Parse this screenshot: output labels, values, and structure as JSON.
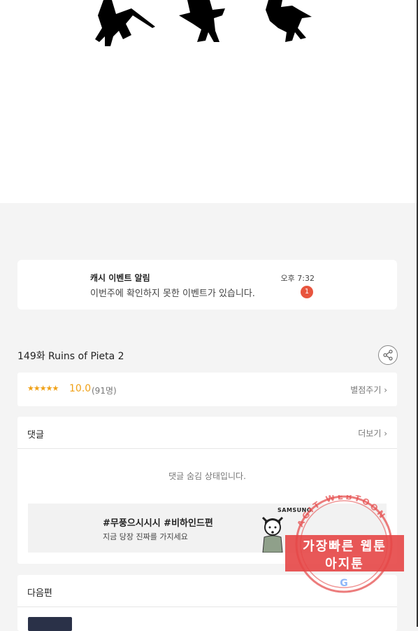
{
  "notification": {
    "title": "캐시 이벤트 알림",
    "body": "이번주에 확인하지 못한 이벤트가 있습니다.",
    "time": "오후 7:32",
    "badge": "1"
  },
  "episode": {
    "title": "149화 Ruins of Pieta 2",
    "share_icon": "share-icon"
  },
  "rating": {
    "stars": "★★★★★",
    "score": "10.0",
    "count": "(91명)",
    "rate_link": "별점주기 ›"
  },
  "comments": {
    "title": "댓글",
    "more": "더보기 ›",
    "hidden_text": "댓글 숨김 상태입니다."
  },
  "ad": {
    "headline": "#무풍으시시시 #비하인드편",
    "subline": "지금 당장 진짜를 가지세요",
    "brand": "SAMSUNG"
  },
  "next": {
    "title": "다음편"
  },
  "watermark": {
    "line1": "가장빠른 웹툰",
    "line2": "아지툰",
    "arc_text": "AGIT WEBTOON"
  }
}
